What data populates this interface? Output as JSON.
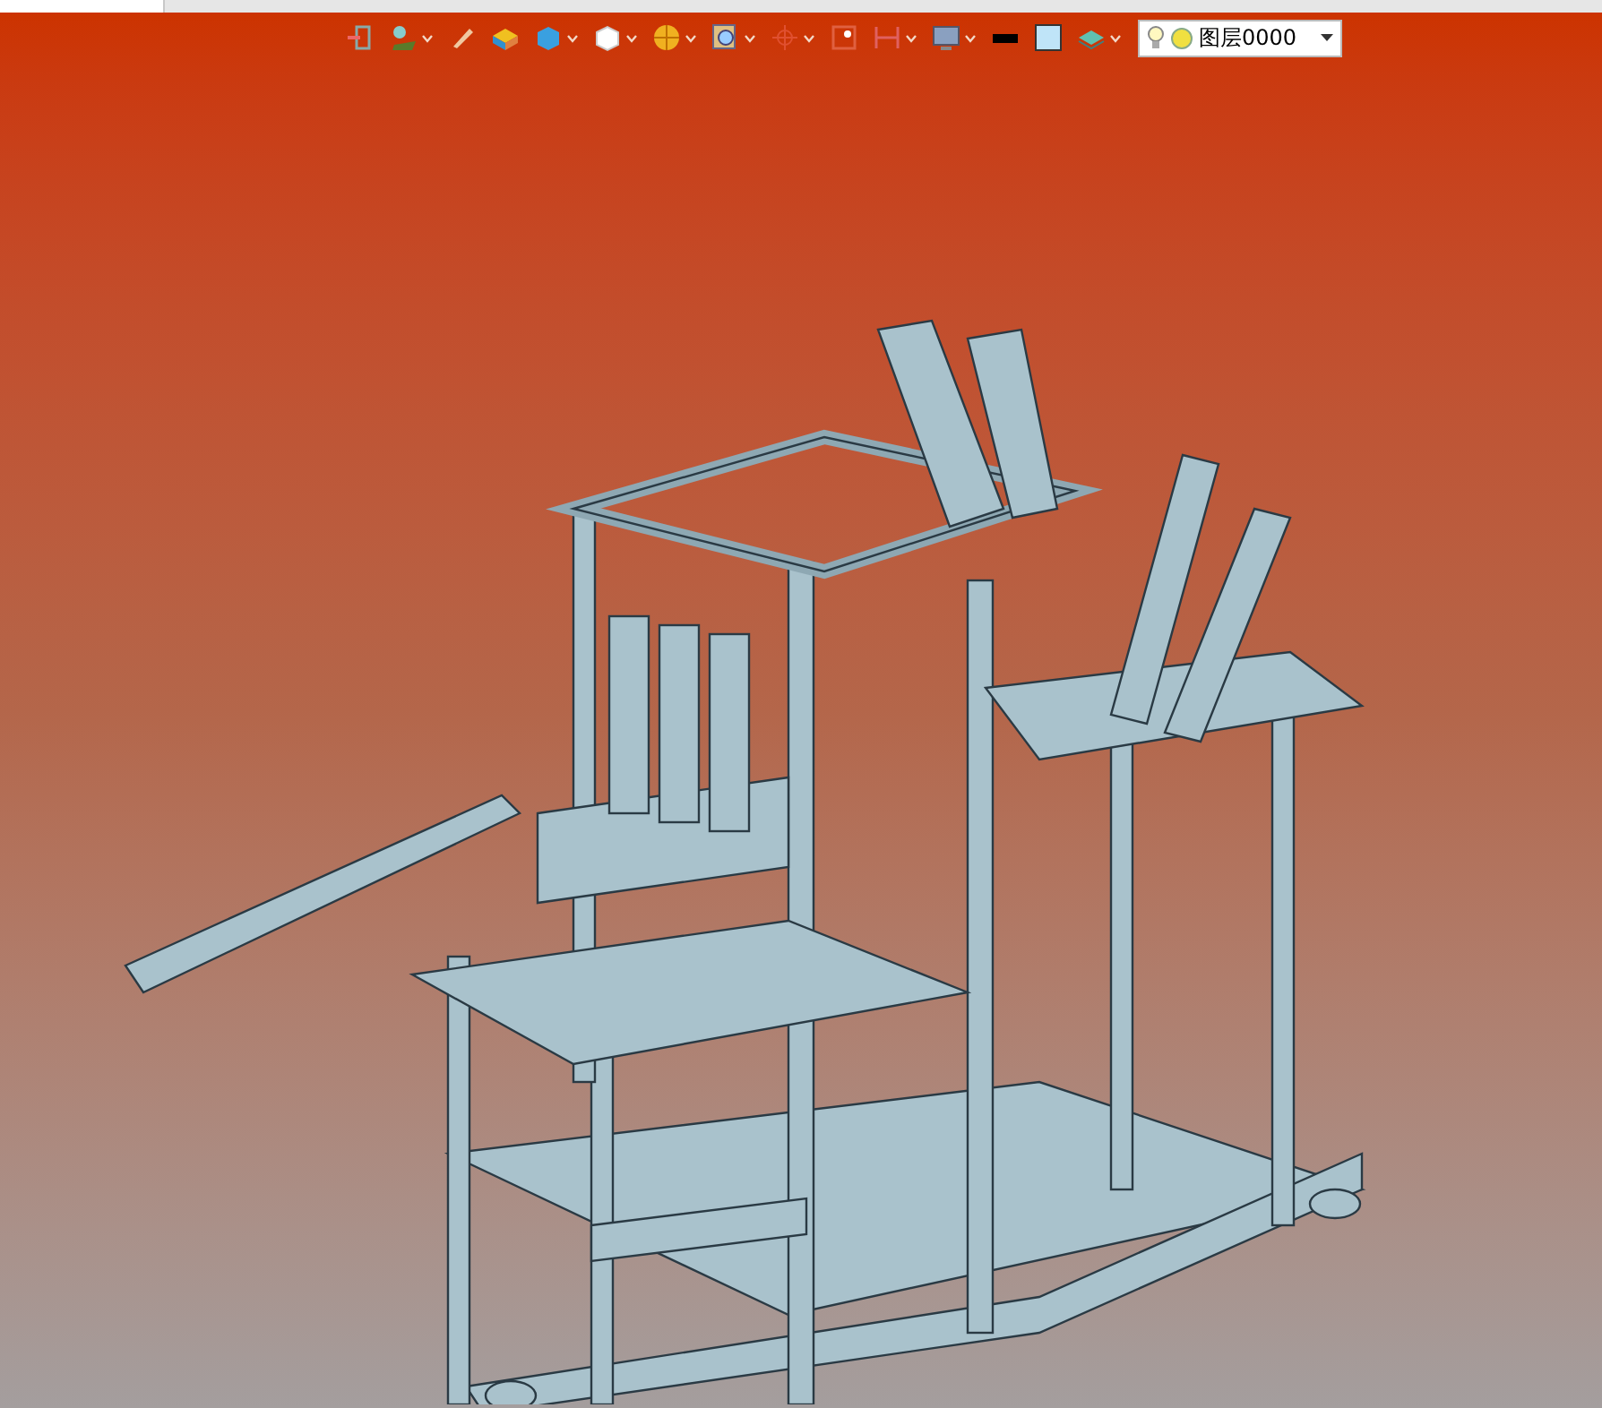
{
  "toolbar": {
    "layer_selector": {
      "value": "图层0000"
    }
  }
}
